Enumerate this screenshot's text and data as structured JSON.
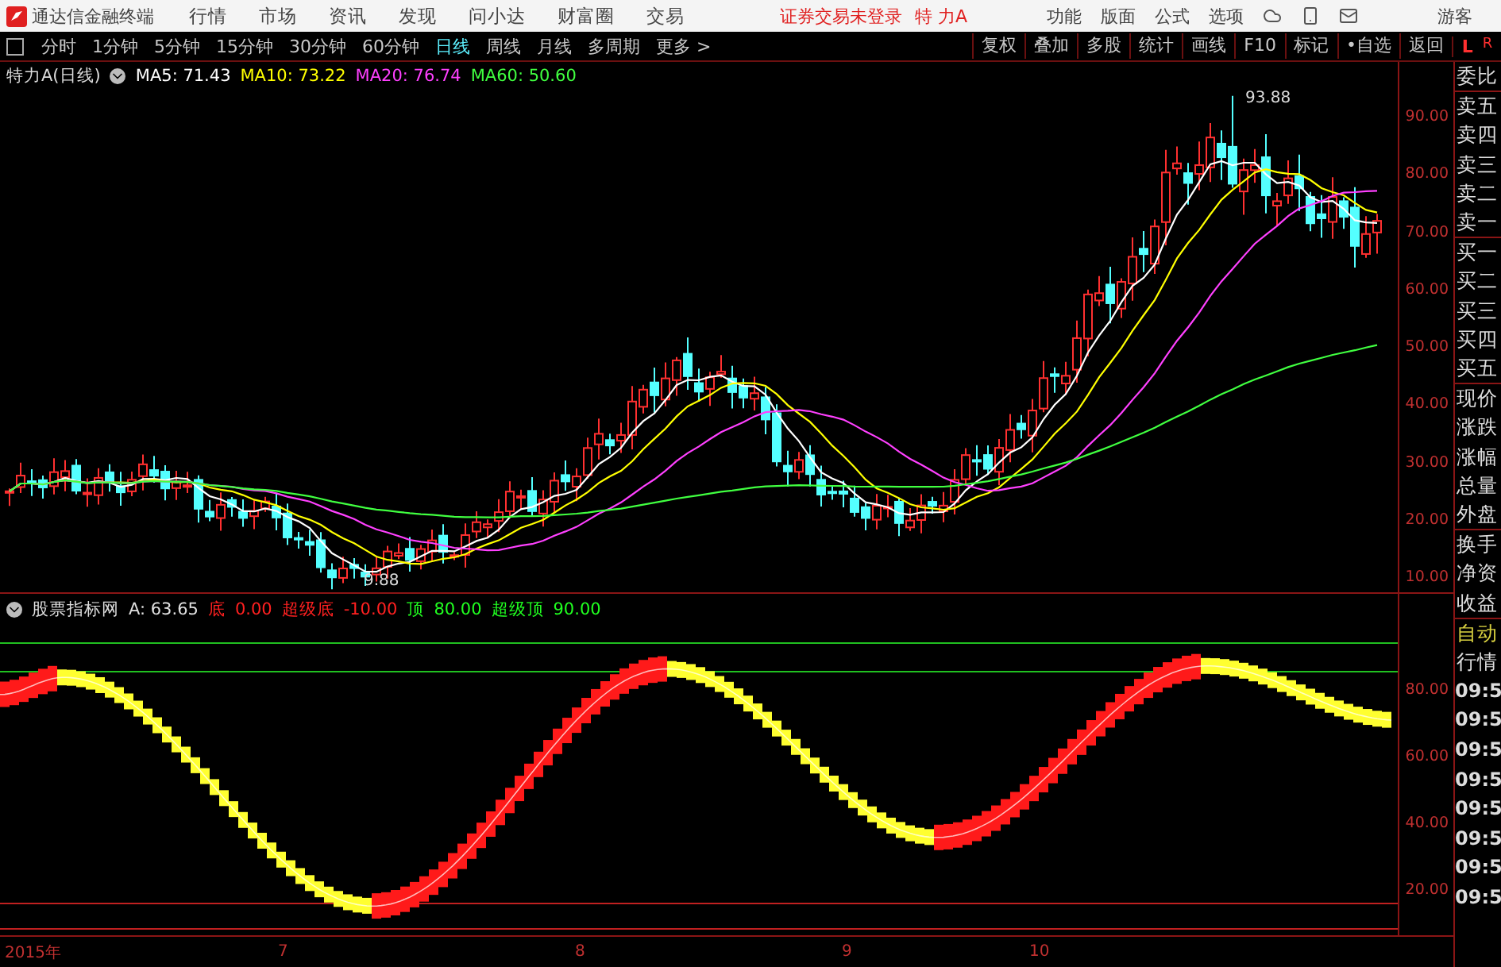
{
  "app_bar": {
    "title": "通达信金融终端",
    "menus": [
      "行情",
      "市场",
      "资讯",
      "发现",
      "问小达",
      "财富圈",
      "交易"
    ],
    "login_status": "证券交易未登录",
    "security": "特 力A",
    "actions": [
      "功能",
      "版面",
      "公式",
      "选项"
    ],
    "user": "游客"
  },
  "period_toolbar": {
    "periods": [
      {
        "label": "分时",
        "selected": false
      },
      {
        "label": "1分钟",
        "selected": false
      },
      {
        "label": "5分钟",
        "selected": false
      },
      {
        "label": "15分钟",
        "selected": false
      },
      {
        "label": "30分钟",
        "selected": false
      },
      {
        "label": "60分钟",
        "selected": false
      },
      {
        "label": "日线",
        "selected": true
      },
      {
        "label": "周线",
        "selected": false
      },
      {
        "label": "月线",
        "selected": false
      },
      {
        "label": "多周期",
        "selected": false
      }
    ],
    "more": "更多 >",
    "tools": [
      "复权",
      "叠加",
      "多股",
      "统计",
      "画线",
      "F10",
      "标记",
      "•自选",
      "返回"
    ],
    "left_mark": "L",
    "right_mark": "R"
  },
  "price_chart": {
    "title": "特力A(日线)",
    "ma": [
      {
        "label": "MA5: 71.43",
        "color": "#ffffff"
      },
      {
        "label": "MA10: 73.22",
        "color": "#ffff00"
      },
      {
        "label": "MA20: 76.74",
        "color": "#ff40ff"
      },
      {
        "label": "MA60: 50.60",
        "color": "#40ff40"
      }
    ],
    "axis_labels": [
      "90.00",
      "80.00",
      "70.00",
      "60.00",
      "50.00",
      "40.00",
      "30.00",
      "20.00",
      "10.00"
    ],
    "high_label": "93.88",
    "low_label": "9.88"
  },
  "indicator": {
    "name": "股票指标网",
    "items": [
      {
        "label": "A: 63.65",
        "color": "#e0e0e0"
      },
      {
        "label": "底",
        "color": "#ff2020"
      },
      {
        "label": "0.00",
        "color": "#ff2020"
      },
      {
        "label": "超级底",
        "color": "#ff2020"
      },
      {
        "label": "-10.00",
        "color": "#ff2020"
      },
      {
        "label": "顶",
        "color": "#20ff20"
      },
      {
        "label": "80.00",
        "color": "#20ff20"
      },
      {
        "label": "超级顶",
        "color": "#20ff20"
      },
      {
        "label": "90.00",
        "color": "#20ff20"
      }
    ],
    "axis_labels": [
      "80.00",
      "60.00",
      "40.00",
      "20.00"
    ]
  },
  "side_panel": {
    "quote_groups": [
      [
        "委比"
      ],
      [
        "卖五",
        "卖四",
        "卖三",
        "卖二",
        "卖一"
      ],
      [
        "买一",
        "买二",
        "买三",
        "买四",
        "买五"
      ],
      [
        "现价",
        "涨跌",
        "涨幅",
        "总量",
        "外盘"
      ],
      [
        "换手",
        "净资",
        "收益"
      ]
    ],
    "mode_labels": [
      "自动",
      "行情"
    ],
    "times": [
      "09:5",
      "09:5",
      "09:5",
      "09:5",
      "09:5",
      "09:5",
      "09:5",
      "09:5"
    ]
  },
  "time_axis": [
    "2015年",
    "7",
    "8",
    "9",
    "10"
  ]
}
